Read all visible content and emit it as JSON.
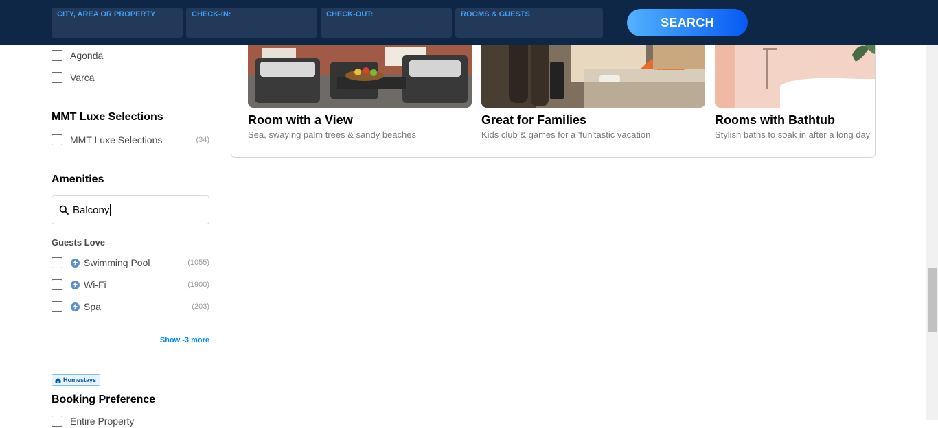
{
  "header": {
    "fields": [
      {
        "label": "CITY, AREA OR PROPERTY"
      },
      {
        "label": "CHECK-IN:"
      },
      {
        "label": "CHECK-OUT:"
      },
      {
        "label": "ROOMS & GUESTS"
      }
    ],
    "search_label": "SEARCH"
  },
  "sidebar": {
    "locality_items": [
      {
        "label": "Agonda"
      },
      {
        "label": "Varca"
      }
    ],
    "luxe": {
      "title": "MMT Luxe Selections",
      "items": [
        {
          "label": "MMT Luxe Selections",
          "count": "(34)"
        }
      ]
    },
    "amenities": {
      "title": "Amenities",
      "search_value": "Balcony",
      "group_title": "Guests Love",
      "items": [
        {
          "label": "Swimming Pool",
          "count": "(1055)"
        },
        {
          "label": "Wi-Fi",
          "count": "(1900)"
        },
        {
          "label": "Spa",
          "count": "(203)"
        }
      ],
      "show_more": "Show -3 more"
    },
    "homestays_badge": "Homestays",
    "booking_preference": {
      "title": "Booking Preference",
      "first_item_partial": "Entire Property"
    }
  },
  "collections": [
    {
      "title": "Room with a View",
      "subtitle": "Sea, swaying palm trees & sandy beaches",
      "icon": "balcony-photo"
    },
    {
      "title": "Great for Families",
      "subtitle": "Kids club & games for a 'fun'tastic vacation",
      "icon": "family-room-photo"
    },
    {
      "title": "Rooms with Bathtub",
      "subtitle": "Stylish baths to soak in after a long day",
      "icon": "bathtub-photo"
    }
  ],
  "colors": {
    "header_bg": "#0e2747",
    "field_label": "#3d9ff5",
    "link_blue": "#008cff"
  }
}
